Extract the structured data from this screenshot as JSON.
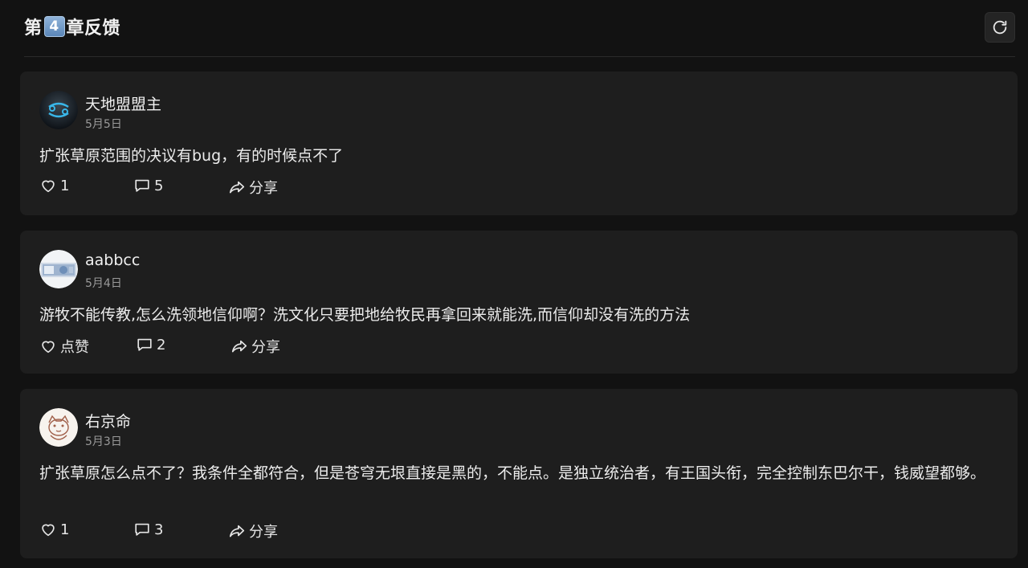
{
  "header": {
    "title_prefix": "第",
    "chapter_number": "4",
    "title_suffix": "章反馈",
    "refresh_icon": "refresh-icon"
  },
  "posts": [
    {
      "author": "天地盟盟主",
      "date": "5月5日",
      "avatar_icon": "cancer-zodiac-avatar",
      "content": "扩张草原范围的决议有bug，有的时候点不了",
      "like_label": "1",
      "comment_count": "5",
      "share_label": "分享"
    },
    {
      "author": "aabbcc",
      "date": "5月4日",
      "avatar_icon": "banknote-avatar",
      "content": "游牧不能传教,怎么洗领地信仰啊？洗文化只要把地给牧民再拿回来就能洗,而信仰却没有洗的方法",
      "like_label": "点赞",
      "comment_count": "2",
      "share_label": "分享"
    },
    {
      "author": "右京命",
      "date": "5月3日",
      "avatar_icon": "cat-sketch-avatar",
      "content": "扩张草原怎么点不了？我条件全都符合，但是苍穹无垠直接是黑的，不能点。是独立统治者，有王国头衔，完全控制东巴尔干，钱威望都够。",
      "like_label": "1",
      "comment_count": "3",
      "share_label": "分享"
    }
  ],
  "icons": {
    "like": "heart-icon",
    "comment": "comment-icon",
    "share": "share-icon"
  },
  "colors": {
    "background": "#121212",
    "card": "#1e1e1e",
    "text": "#e8e8e8",
    "muted": "#9a9a9a",
    "badge": "#6b93c2"
  }
}
